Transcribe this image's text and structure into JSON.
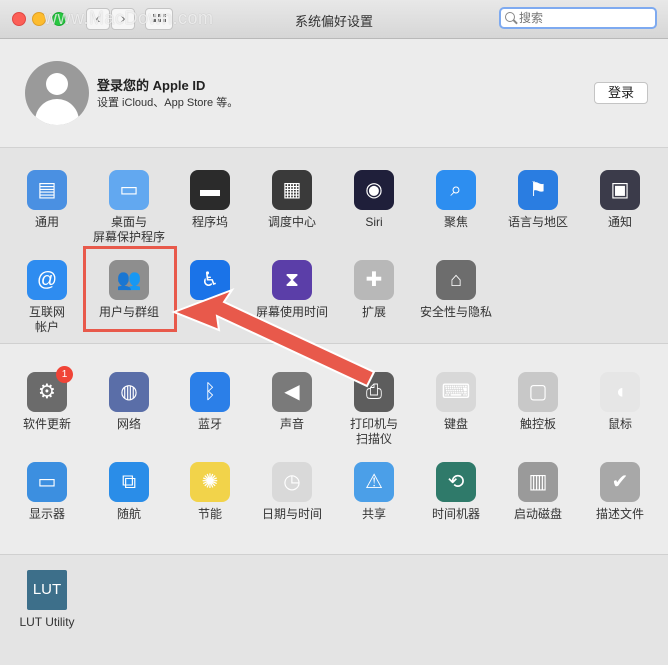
{
  "window": {
    "title": "系统偏好设置",
    "watermark": "www.MacDown.com"
  },
  "toolbar": {
    "back": "‹",
    "forward": "›"
  },
  "search": {
    "placeholder": "搜索"
  },
  "account": {
    "title": "登录您的 Apple ID",
    "subtitle": "设置 iCloud、App Store 等。",
    "login_button": "登录"
  },
  "section1": [
    {
      "label": "通用",
      "icon": "general-icon",
      "color": "#4a90e2"
    },
    {
      "label": "桌面与\n屏幕保护程序",
      "icon": "desktop-icon",
      "color": "#62a8f0"
    },
    {
      "label": "程序坞",
      "icon": "dock-icon",
      "color": "#2b2b2b"
    },
    {
      "label": "调度中心",
      "icon": "mission-control-icon",
      "color": "#3a3a3a"
    },
    {
      "label": "Siri",
      "icon": "siri-icon",
      "color": "#1f1f3a"
    },
    {
      "label": "聚焦",
      "icon": "spotlight-icon",
      "color": "#2d8ef0"
    },
    {
      "label": "语言与地区",
      "icon": "language-icon",
      "color": "#2a7de1"
    },
    {
      "label": "通知",
      "icon": "notifications-icon",
      "color": "#3b3b4a"
    },
    {
      "label": "互联网\n帐户",
      "icon": "internet-accounts-icon",
      "color": "#2e8cf0"
    },
    {
      "label": "用户与群组",
      "icon": "users-groups-icon",
      "color": "#8e8e8e"
    },
    {
      "label": "辅助",
      "icon": "accessibility-icon",
      "color": "#1a73e8"
    },
    {
      "label": "屏幕使用时间",
      "icon": "screen-time-icon",
      "color": "#5b3ea8"
    },
    {
      "label": "扩展",
      "icon": "extensions-icon",
      "color": "#b8b8b8"
    },
    {
      "label": "安全性与隐私",
      "icon": "security-icon",
      "color": "#6d6d6d"
    }
  ],
  "section2": [
    {
      "label": "软件更新",
      "icon": "software-update-icon",
      "color": "#6b6b6b",
      "badge": "1"
    },
    {
      "label": "网络",
      "icon": "network-icon",
      "color": "#5a6ea8"
    },
    {
      "label": "蓝牙",
      "icon": "bluetooth-icon",
      "color": "#2b7fe8"
    },
    {
      "label": "声音",
      "icon": "sound-icon",
      "color": "#7a7a7a"
    },
    {
      "label": "打印机与\n扫描仪",
      "icon": "printer-icon",
      "color": "#5d5d5d"
    },
    {
      "label": "键盘",
      "icon": "keyboard-icon",
      "color": "#d8d8d8"
    },
    {
      "label": "触控板",
      "icon": "trackpad-icon",
      "color": "#c8c8c8"
    },
    {
      "label": "鼠标",
      "icon": "mouse-icon",
      "color": "#e6e6e6"
    },
    {
      "label": "显示器",
      "icon": "display-icon",
      "color": "#3c8fe0"
    },
    {
      "label": "随航",
      "icon": "sidecar-icon",
      "color": "#2a8de8"
    },
    {
      "label": "节能",
      "icon": "energy-saver-icon",
      "color": "#f2d34a"
    },
    {
      "label": "日期与时间",
      "icon": "date-time-icon",
      "color": "#d9d9d9"
    },
    {
      "label": "共享",
      "icon": "sharing-icon",
      "color": "#4b9fe8"
    },
    {
      "label": "时间机器",
      "icon": "time-machine-icon",
      "color": "#2f7a6a"
    },
    {
      "label": "启动磁盘",
      "icon": "startup-disk-icon",
      "color": "#9a9a9a"
    },
    {
      "label": "描述文件",
      "icon": "profiles-icon",
      "color": "#a8a8a8"
    }
  ],
  "section3": [
    {
      "label": "LUT Utility",
      "icon": "lut-utility-icon",
      "color": "#3d6f8a",
      "glyph": "LUT"
    }
  ]
}
